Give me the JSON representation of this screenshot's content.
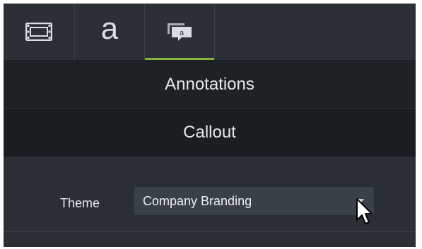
{
  "tabs": [
    {
      "icon": "film-icon",
      "active": false
    },
    {
      "label": "a",
      "icon": "text-icon",
      "active": false
    },
    {
      "icon": "annotation-callout-icon",
      "active": true
    }
  ],
  "sections": {
    "header": "Annotations",
    "subheader": "Callout"
  },
  "properties": {
    "theme_label": "Theme",
    "theme_value": "Company Branding"
  },
  "colors": {
    "accent_underline": "#86b33e",
    "panel_bg": "#23272c"
  }
}
